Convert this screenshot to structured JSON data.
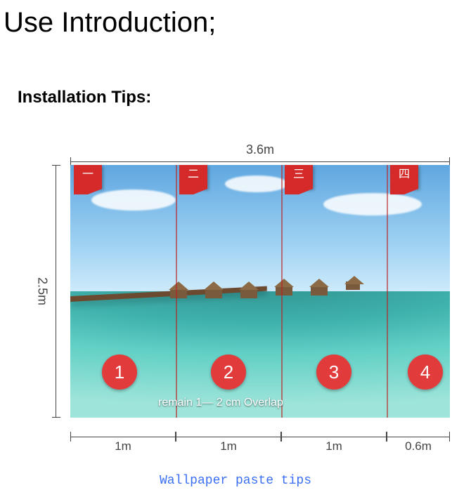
{
  "title": "Use Introduction;",
  "section_title": "Installation Tips:",
  "dimensions": {
    "total_width": "3.6m",
    "total_height": "2.5m"
  },
  "panels": [
    {
      "tab_label": "一",
      "number": "1",
      "width_label": "1m"
    },
    {
      "tab_label": "二",
      "number": "2",
      "width_label": "1m"
    },
    {
      "tab_label": "三",
      "number": "3",
      "width_label": "1m"
    },
    {
      "tab_label": "四",
      "number": "4",
      "width_label": "0.6m"
    }
  ],
  "overlap_note": "remain 1— 2 cm Overlap",
  "caption": "Wallpaper paste tips"
}
